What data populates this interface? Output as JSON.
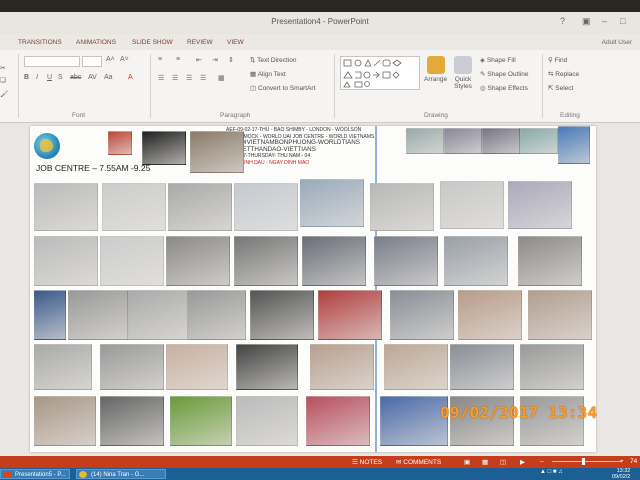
{
  "window": {
    "title": "Presentation4 - PowerPoint"
  },
  "tabs": [
    "TRANSITIONS",
    "ANIMATIONS",
    "SLIDE SHOW",
    "REVIEW",
    "VIEW"
  ],
  "user": "Adult User",
  "ribbon": {
    "paragraph": {
      "text_direction": "Text Direction",
      "align_text": "Align Text",
      "smartart": "Convert to SmartArt",
      "label": "Paragraph"
    },
    "font": {
      "label": "Font",
      "format_buttons": [
        "B",
        "I",
        "U",
        "S",
        "abc",
        "AV",
        "Aa",
        "A"
      ]
    },
    "drawing": {
      "arrange": "Arrange",
      "quick_styles": "Quick Styles",
      "shape_fill": "Shape Fill",
      "shape_outline": "Shape Outline",
      "shape_effects": "Shape Effects",
      "label": "Drawing"
    },
    "editing": {
      "find": "Find",
      "replace": "Replace",
      "select": "Select",
      "label": "Editing"
    }
  },
  "slide": {
    "heading": "JOB CENTRE – 7.55AM -9.25",
    "info_lines": [
      "AEF-09-02-17-THU - BAO SHIMBY - LONDON - WOOLSON",
      "IN HAMMOCK - WORLD UAI JOB CENTRE - WORLD VIETNAMS",
      "NGUOIVIETNAMBONPHUONG-WORLDTIANS",
      "DAIVIETTHANDAO-VIETTIANS",
      "09-02-17-THURSDAY- THU NAM - 04"
    ],
    "info_red": "13-01-DINH DAU - NGAY DINH MAO"
  },
  "status": {
    "notes": "NOTES",
    "comments": "COMMENTS",
    "zoom": "74"
  },
  "taskbar": {
    "tasks": [
      "Presentation5 - P...",
      "(14) Nina Tran - G..."
    ],
    "time": "13:32",
    "date": "09/02/2"
  },
  "camera_stamp": "09/02/2017  13:34"
}
